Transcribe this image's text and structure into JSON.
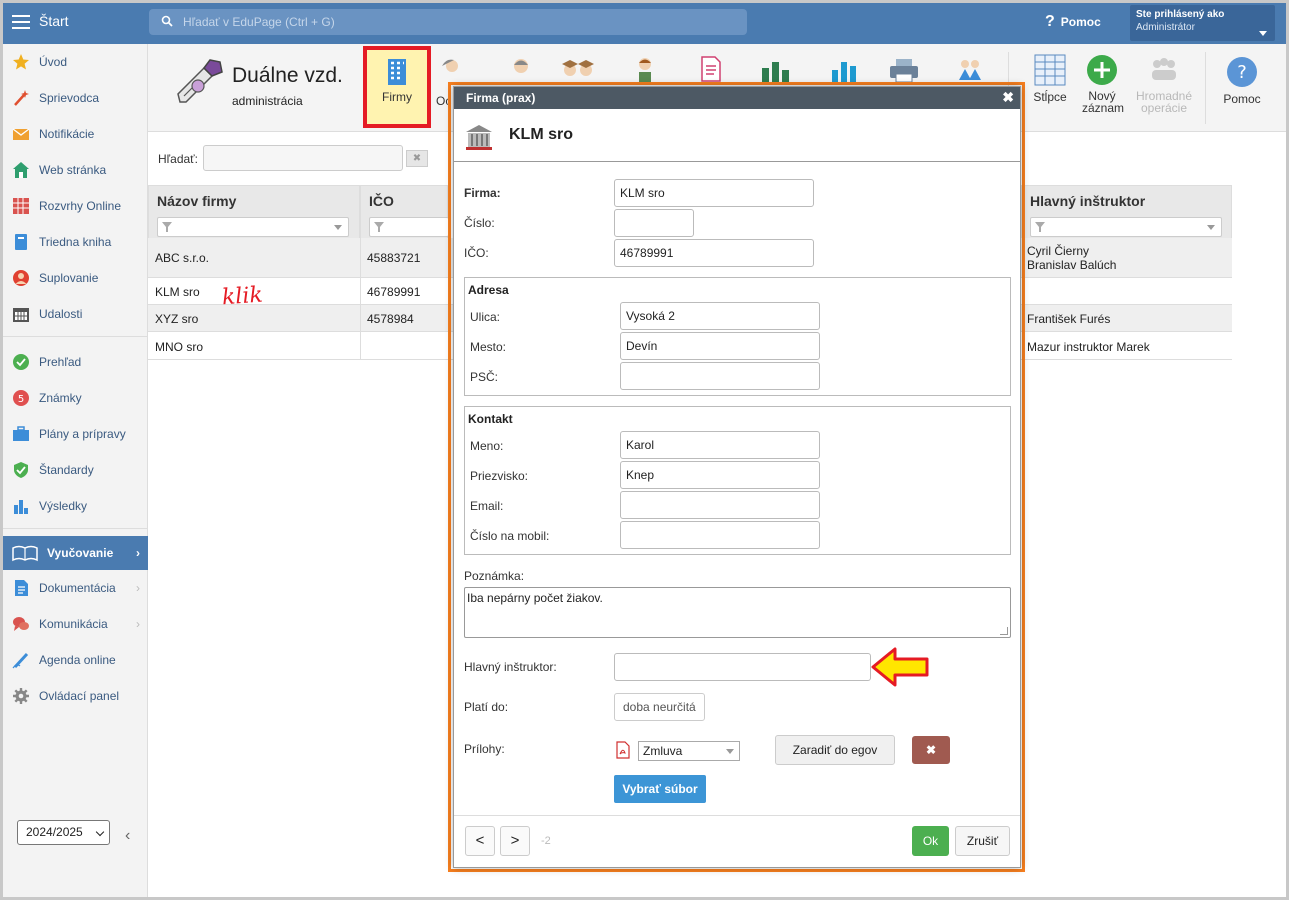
{
  "topbar": {
    "start_label": "Štart",
    "search_placeholder": "Hľadať v EduPage (Ctrl + G)",
    "help_label": "Pomoc",
    "user_line1": "Ste prihlásený ako",
    "user_line2": "Administrátor"
  },
  "sidebar": {
    "items": [
      {
        "label": "Úvod",
        "icon": "star-icon",
        "color": "#f0b020"
      },
      {
        "label": "Sprievodca",
        "icon": "wand-icon",
        "color": "#e05030"
      },
      {
        "label": "Notifikácie",
        "icon": "envelope-icon",
        "color": "#f0a030"
      },
      {
        "label": "Web stránka",
        "icon": "house-icon",
        "color": "#2e9e6e"
      },
      {
        "label": "Rozvrhy Online",
        "icon": "grid-icon",
        "color": "#d9534f"
      },
      {
        "label": "Triedna kniha",
        "icon": "book-icon",
        "color": "#3c8dd8"
      },
      {
        "label": "Suplovanie",
        "icon": "person-icon",
        "color": "#e04030"
      },
      {
        "label": "Udalosti",
        "icon": "calendar-icon",
        "color": "#555555"
      },
      {
        "label": "Prehľad",
        "icon": "check-circle-icon",
        "color": "#4caf50"
      },
      {
        "label": "Známky",
        "icon": "grade-icon",
        "color": "#e05050"
      },
      {
        "label": "Plány a prípravy",
        "icon": "briefcase-icon",
        "color": "#3c8dd8"
      },
      {
        "label": "Štandardy",
        "icon": "shield-check-icon",
        "color": "#4caf50"
      },
      {
        "label": "Výsledky",
        "icon": "bar-chart-icon",
        "color": "#3c8dd8"
      },
      {
        "label": "Vyučovanie",
        "icon": "open-book-icon",
        "color": "#ffffff"
      },
      {
        "label": "Dokumentácia",
        "icon": "document-icon",
        "color": "#3c8dd8"
      },
      {
        "label": "Komunikácia",
        "icon": "chat-icon",
        "color": "#d9534f"
      },
      {
        "label": "Agenda online",
        "icon": "pen-icon",
        "color": "#3c8dd8"
      },
      {
        "label": "Ovládací panel",
        "icon": "gear-icon",
        "color": "#888888"
      }
    ],
    "year": "2024/2025"
  },
  "module": {
    "title": "Duálne vzd.",
    "subtitle": "administrácia",
    "buttons": {
      "firmy": "Firmy",
      "second_partial": "Oc",
      "stlpce": "Stĺpce",
      "novy_zaznam_1": "Nový",
      "novy_zaznam_2": "záznam",
      "hromadne_1": "Hromadné",
      "hromadne_2": "operácie",
      "pomoc": "Pomoc"
    }
  },
  "search": {
    "label": "Hľadať:"
  },
  "table": {
    "columns": [
      "Názov firmy",
      "IČO",
      "Hlavný inštruktor"
    ],
    "rows": [
      {
        "name": "ABC s.r.o.",
        "ico": "45883721",
        "instr1": "Cyril Čierny",
        "instr2": "Branislav Balúch"
      },
      {
        "name": "KLM sro",
        "ico": "46789991",
        "instr1": "",
        "instr2": ""
      },
      {
        "name": "XYZ sro",
        "ico": "4578984",
        "instr1": "František Furés",
        "instr2": ""
      },
      {
        "name": "MNO sro",
        "ico": "",
        "instr1": "Mazur instruktor Marek",
        "instr2": ""
      }
    ],
    "annotation": "klik"
  },
  "modal": {
    "title": "Firma (prax)",
    "header": "KLM sro",
    "labels": {
      "firma": "Firma:",
      "cislo": "Číslo:",
      "ico": "IČO:",
      "adresa": "Adresa",
      "ulica": "Ulica:",
      "mesto": "Mesto:",
      "psc": "PSČ:",
      "kontakt": "Kontakt",
      "meno": "Meno:",
      "priezvisko": "Priezvisko:",
      "email": "Email:",
      "mobil": "Číslo na mobil:",
      "poznamka": "Poznámka:",
      "instruktor": "Hlavný inštruktor:",
      "plati_do": "Platí do:",
      "prilohy": "Prílohy:"
    },
    "values": {
      "firma": "KLM sro",
      "cislo": "",
      "ico": "46789991",
      "ulica": "Vysoká 2",
      "mesto": "Devín",
      "psc": "",
      "meno": "Karol",
      "priezvisko": "Knep",
      "email": "",
      "mobil": "",
      "poznamka": "Iba nepárny počet žiakov.",
      "instruktor": "",
      "plati_do": "doba neurčitá",
      "priloha": "Zmluva"
    },
    "buttons": {
      "zaradit": "Zaradiť do egov",
      "delete": "✖",
      "vybrat": "Vybrať súbor",
      "prev": "<",
      "next": ">",
      "page": "-2",
      "ok": "Ok",
      "cancel": "Zrušiť"
    }
  },
  "colors": {
    "topbar": "#4a7bb0",
    "highlight_red": "#e51b24",
    "modal_outline": "#f77f1f",
    "ok_green": "#4caf50",
    "primary_blue": "#3c95d6",
    "arrow_yellow": "#ffe600"
  }
}
